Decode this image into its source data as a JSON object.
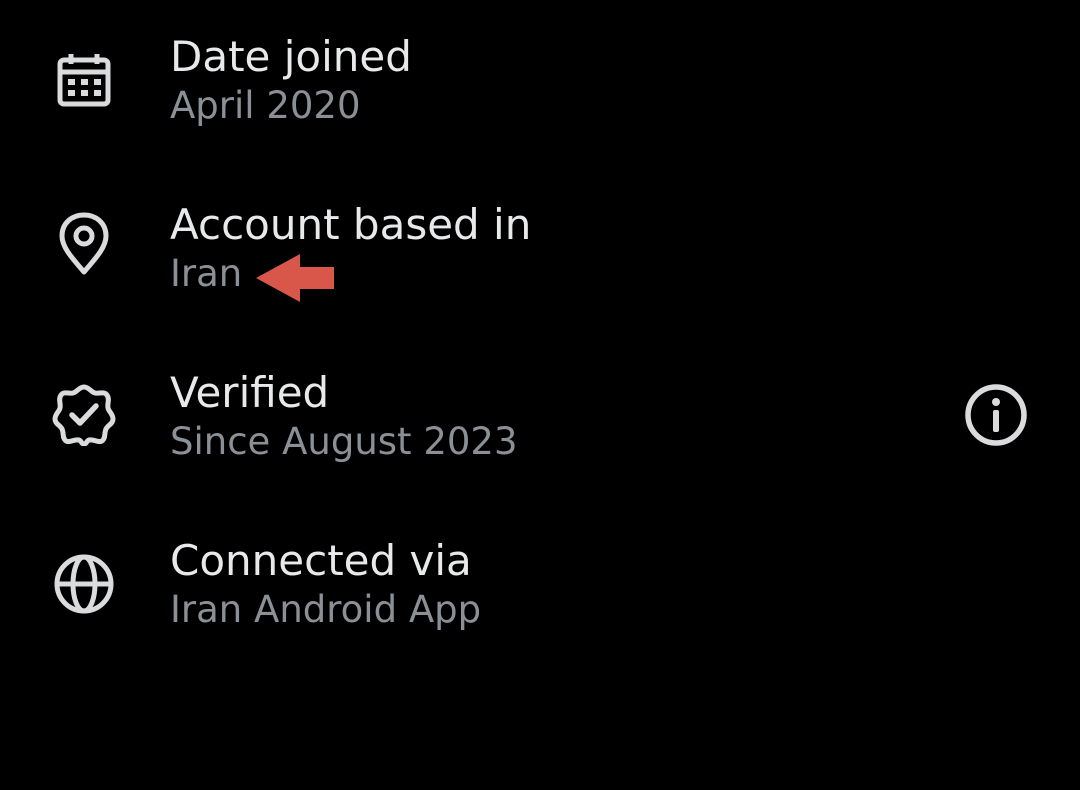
{
  "rows": [
    {
      "icon": "calendar-icon",
      "title": "Date joined",
      "subtitle": "April 2020"
    },
    {
      "icon": "location-pin-icon",
      "title": "Account based in",
      "subtitle": "Iran"
    },
    {
      "icon": "verified-badge-icon",
      "title": "Verified",
      "subtitle": "Since August 2023",
      "action_icon": "info-icon"
    },
    {
      "icon": "globe-icon",
      "title": "Connected via",
      "subtitle": "Iran Android App"
    }
  ],
  "colors": {
    "background": "#000000",
    "title_text": "#e7e9ea",
    "subtitle_text": "#8b9096",
    "icon": "#d9dbdd",
    "annotation_arrow": "#d9574a"
  }
}
